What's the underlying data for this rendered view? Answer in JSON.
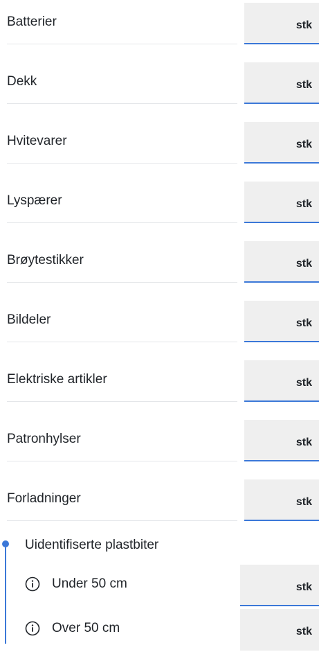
{
  "items": [
    {
      "label": "Batterier",
      "unit": "stk",
      "value": ""
    },
    {
      "label": "Dekk",
      "unit": "stk",
      "value": ""
    },
    {
      "label": "Hvitevarer",
      "unit": "stk",
      "value": ""
    },
    {
      "label": "Lyspærer",
      "unit": "stk",
      "value": ""
    },
    {
      "label": "Brøytestikker",
      "unit": "stk",
      "value": ""
    },
    {
      "label": "Bildeler",
      "unit": "stk",
      "value": ""
    },
    {
      "label": "Elektriske artikler",
      "unit": "stk",
      "value": ""
    },
    {
      "label": "Patronhylser",
      "unit": "stk",
      "value": ""
    },
    {
      "label": "Forladninger",
      "unit": "stk",
      "value": ""
    }
  ],
  "group": {
    "title": "Uidentifiserte plastbiter",
    "accent_color": "#3b78d8",
    "items": [
      {
        "label": "Under 50 cm",
        "unit": "stk",
        "value": "",
        "icon": "info-icon"
      },
      {
        "label": "Over 50 cm",
        "unit": "stk",
        "value": "",
        "icon": "info-icon"
      }
    ]
  }
}
